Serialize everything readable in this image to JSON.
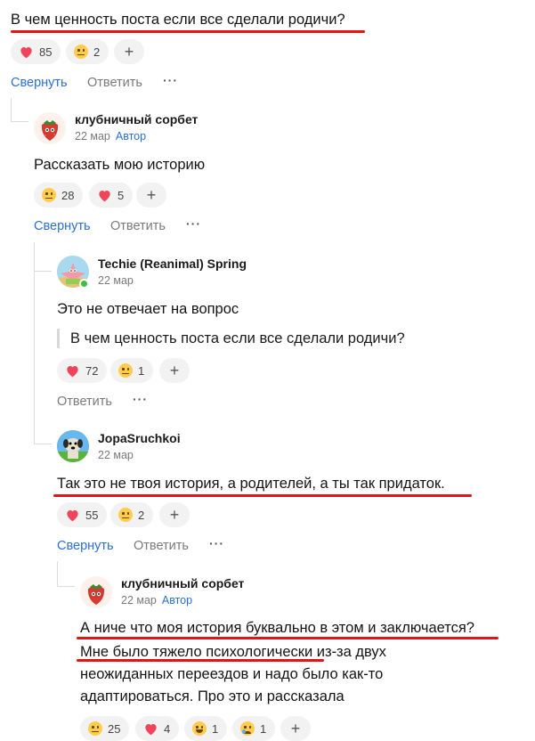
{
  "post": {
    "text": "В чем ценность поста если все сделали родичи?",
    "reactions": [
      {
        "icon": "heart-icon",
        "count": "85"
      },
      {
        "icon": "neutral-face-icon",
        "count": "2"
      }
    ],
    "actions": {
      "collapse": "Свернуть",
      "reply": "Ответить"
    }
  },
  "comments": [
    {
      "author": "клубничный сорбет",
      "date": "22 мар",
      "badge": "Автор",
      "text": "Рассказать мою историю",
      "reactions": [
        {
          "icon": "neutral-face-icon",
          "count": "28"
        },
        {
          "icon": "heart-icon",
          "count": "5"
        }
      ],
      "actions": {
        "collapse": "Свернуть",
        "reply": "Ответить"
      }
    },
    {
      "author": "Techie (Reanimal) Spring",
      "date": "22 мар",
      "text": "Это не отвечает на вопрос",
      "quote": "В чем ценность поста если все сделали родичи?",
      "reactions": [
        {
          "icon": "heart-icon",
          "count": "72"
        },
        {
          "icon": "neutral-face-icon",
          "count": "1"
        }
      ],
      "actions": {
        "reply": "Ответить"
      }
    },
    {
      "author": "JopaSruchkoi",
      "date": "22 мар",
      "text": "Так это не твоя история, а родителей, а ты так придаток.",
      "reactions": [
        {
          "icon": "heart-icon",
          "count": "55"
        },
        {
          "icon": "neutral-face-icon",
          "count": "2"
        }
      ],
      "actions": {
        "collapse": "Свернуть",
        "reply": "Ответить"
      }
    },
    {
      "author": "клубничный сорбет",
      "date": "22 мар",
      "badge": "Автор",
      "lines": [
        "А ниче что моя история буквально в этом и заключается?",
        "Мне было тяжело психологически из-за двух",
        "неожиданных переездов и надо было как-то",
        "адаптироваться. Про это и рассказала"
      ],
      "reactions": [
        {
          "icon": "neutral-face-icon",
          "count": "25"
        },
        {
          "icon": "heart-icon",
          "count": "4"
        },
        {
          "icon": "tears-of-joy-icon",
          "count": "1"
        },
        {
          "icon": "crying-face-icon",
          "count": "1"
        }
      ]
    }
  ],
  "colors": {
    "accent": "#2b6fd6",
    "annotation": "#e31414",
    "heart": "#f0445a",
    "emoji": "#ffcc4d"
  }
}
